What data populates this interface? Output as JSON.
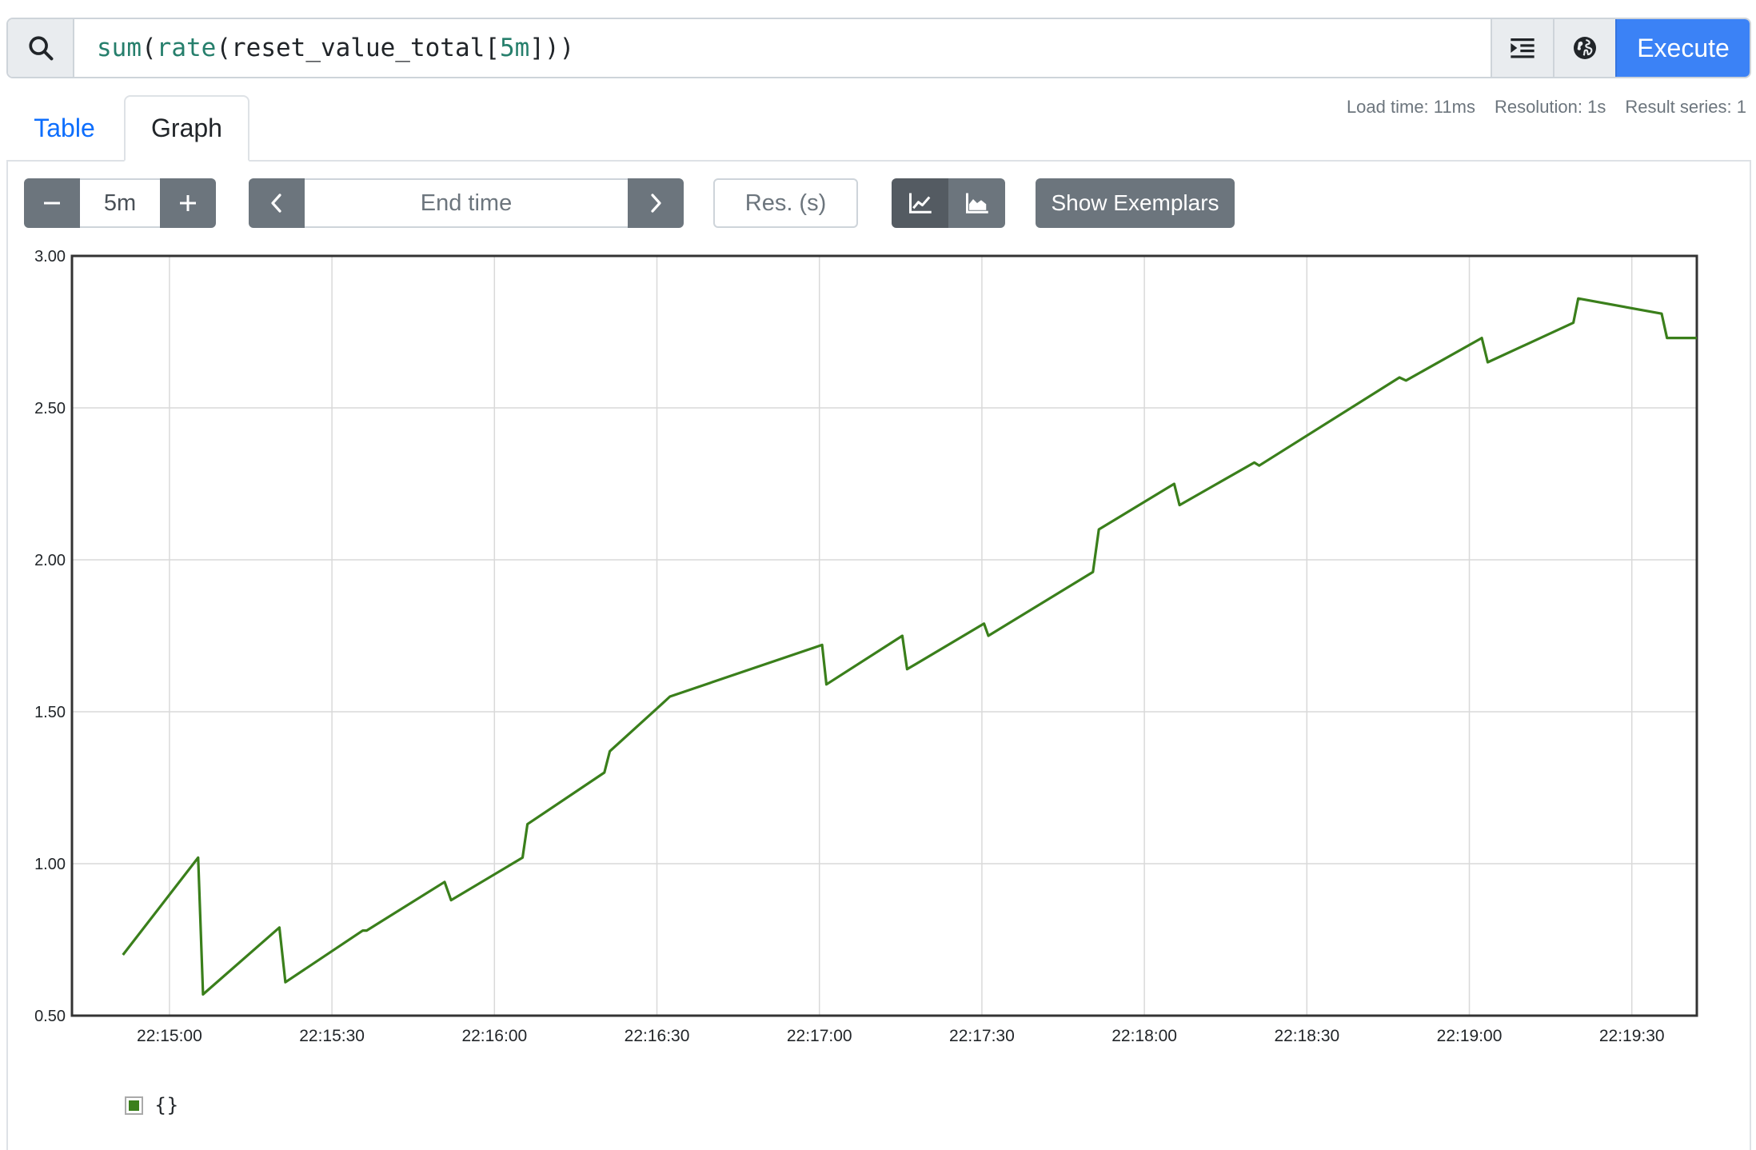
{
  "query": {
    "fn_outer": "sum",
    "fn_inner": "rate",
    "metric": "reset_value_total",
    "range": "5m",
    "execute_label": "Execute"
  },
  "stats": {
    "load_time": "Load time: 11ms",
    "resolution": "Resolution: 1s",
    "result_series": "Result series: 1"
  },
  "tabs": [
    {
      "label": "Table",
      "active": false
    },
    {
      "label": "Graph",
      "active": true
    }
  ],
  "controls": {
    "range_value": "5m",
    "end_time_placeholder": "End time",
    "resolution_placeholder": "Res. (s)",
    "exemplars_label": "Show Exemplars"
  },
  "chart_data": {
    "type": "line",
    "ylim": [
      0.5,
      3.0
    ],
    "yticks": [
      "0.50",
      "1.00",
      "1.50",
      "2.00",
      "2.50",
      "3.00"
    ],
    "xticks": [
      {
        "t": 60,
        "label": "22:15:00"
      },
      {
        "t": 90,
        "label": "22:15:30"
      },
      {
        "t": 120,
        "label": "22:16:00"
      },
      {
        "t": 150,
        "label": "22:16:30"
      },
      {
        "t": 180,
        "label": "22:17:00"
      },
      {
        "t": 210,
        "label": "22:17:30"
      },
      {
        "t": 240,
        "label": "22:18:00"
      },
      {
        "t": 270,
        "label": "22:18:30"
      },
      {
        "t": 300,
        "label": "22:19:00"
      },
      {
        "t": 330,
        "label": "22:19:30"
      }
    ],
    "xlim": [
      42,
      342
    ],
    "color": "#3a7f1b",
    "series": [
      {
        "name": "{}",
        "x": [
          51.4,
          65.3,
          66.2,
          80.3,
          81.4,
          95.7,
          96.4,
          110.8,
          112,
          125.2,
          126.1,
          140.3,
          141.3,
          151.2,
          152.4,
          180.5,
          181.3,
          195.3,
          196.2,
          210.4,
          211.2,
          230.5,
          231.6,
          245.5,
          246.5,
          260.3,
          261.2,
          287.1,
          288.3,
          302.3,
          303.4,
          319.2,
          320.1,
          335.5,
          336.5,
          342
        ],
        "y": [
          0.7,
          1.02,
          0.57,
          0.79,
          0.61,
          0.78,
          0.78,
          0.94,
          0.88,
          1.02,
          1.13,
          1.3,
          1.37,
          1.53,
          1.55,
          1.72,
          1.59,
          1.75,
          1.64,
          1.79,
          1.75,
          1.96,
          2.1,
          2.25,
          2.18,
          2.32,
          2.31,
          2.6,
          2.59,
          2.73,
          2.65,
          2.78,
          2.86,
          2.81,
          2.73,
          2.73
        ]
      }
    ]
  },
  "legend": {
    "label": "{}"
  }
}
